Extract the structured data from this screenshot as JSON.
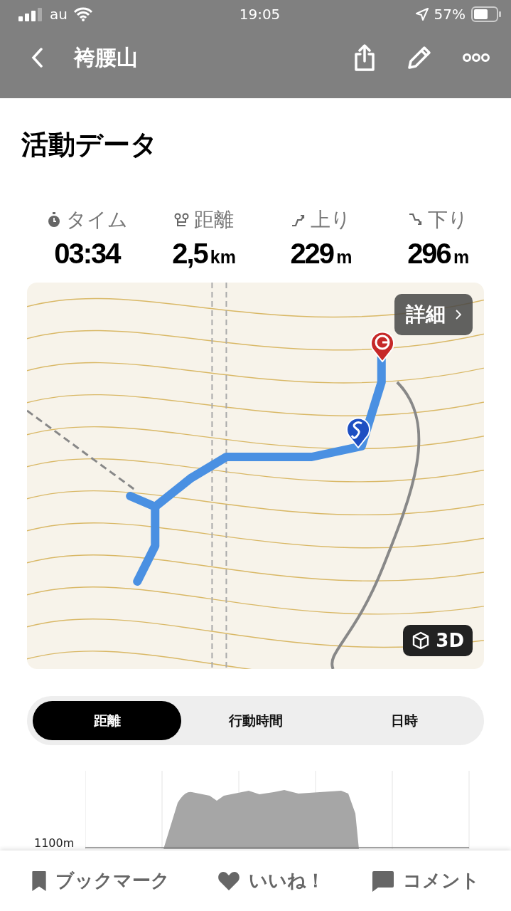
{
  "status_bar": {
    "carrier": "au",
    "time": "19:05",
    "battery": "57%"
  },
  "header": {
    "title": "袴腰山"
  },
  "section_title": "活動データ",
  "stats": [
    {
      "kind": "time",
      "label": "タイム",
      "value": "03:34"
    },
    {
      "kind": "distance",
      "label": "距離",
      "value": "2,5",
      "unit": "km"
    },
    {
      "kind": "ascent",
      "label": "上り",
      "value": "229",
      "unit": "m"
    },
    {
      "kind": "descent",
      "label": "下り",
      "value": "296",
      "unit": "m"
    }
  ],
  "map": {
    "kind": "picture",
    "detail_button": "詳細",
    "view_3d_button": "3D"
  },
  "segments": [
    {
      "label": "距離",
      "selected": true
    },
    {
      "label": "行動時間",
      "selected": false
    },
    {
      "label": "日時",
      "selected": false
    }
  ],
  "elevation": {
    "axis_label": "1100m"
  },
  "actions": [
    {
      "kind": "bookmark",
      "label": "ブックマーク"
    },
    {
      "kind": "like",
      "label": "いいね！"
    },
    {
      "kind": "comment",
      "label": "コメント"
    }
  ]
}
